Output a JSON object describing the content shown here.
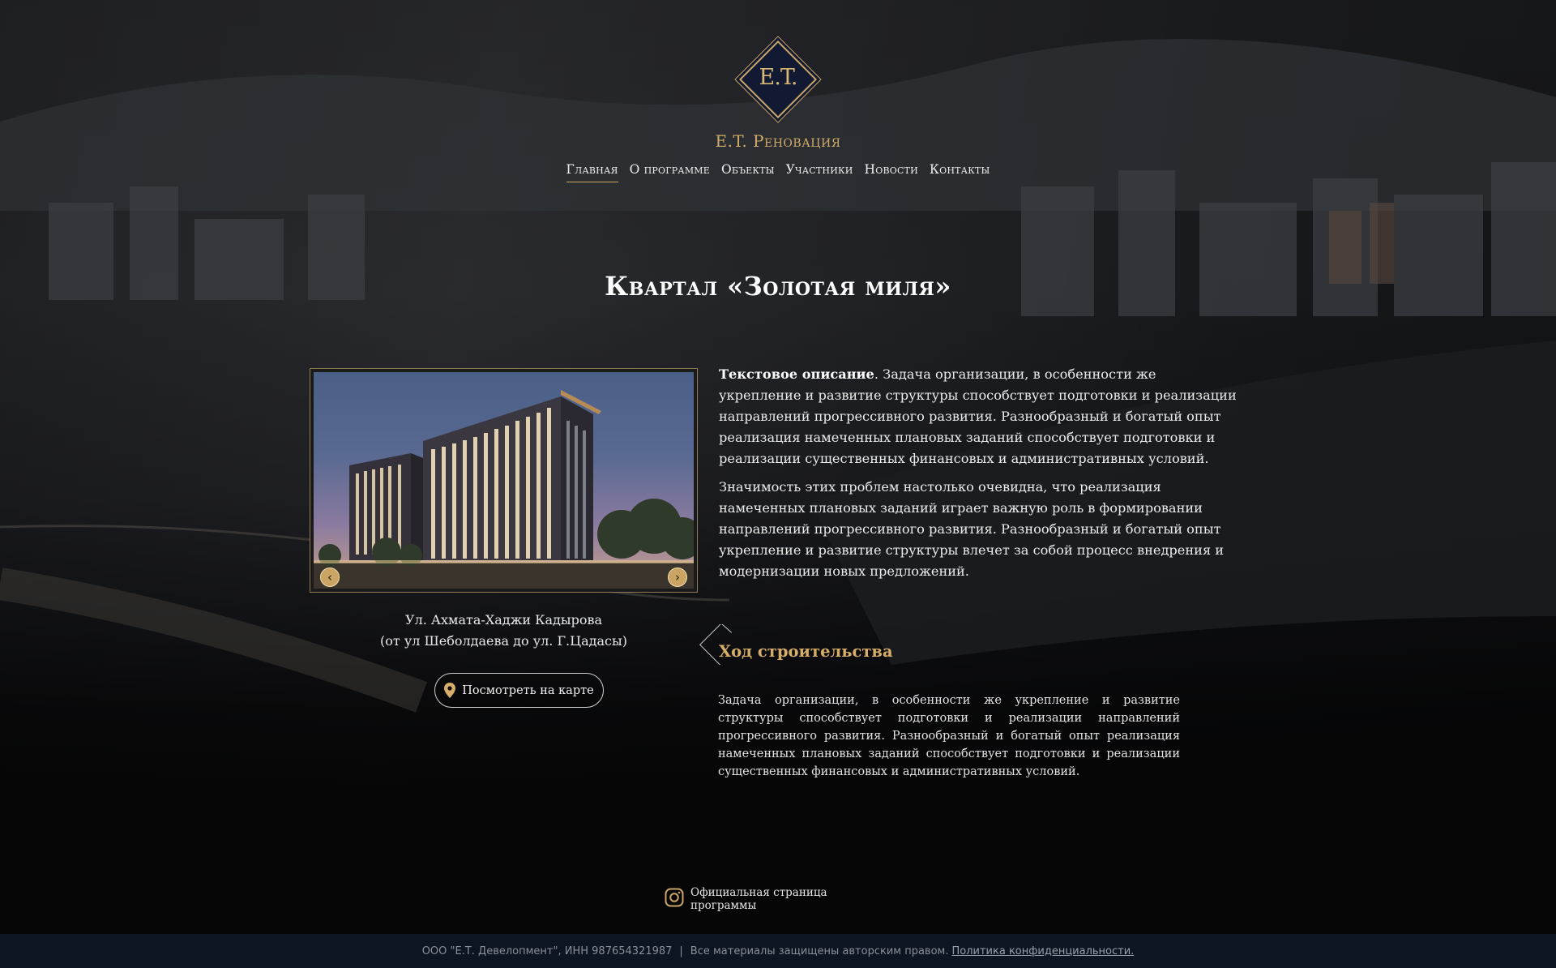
{
  "logo": {
    "monogram": "E.T."
  },
  "brand": {
    "name": "E.T. Реновация"
  },
  "nav": [
    {
      "label": "Главная",
      "active": true
    },
    {
      "label": "О программе"
    },
    {
      "label": "Объекты"
    },
    {
      "label": "Участники"
    },
    {
      "label": "Новости"
    },
    {
      "label": "Контакты"
    }
  ],
  "page": {
    "title": "Квартал «Золотая миля»"
  },
  "slider": {
    "prev_icon": "chevron-left-icon",
    "next_icon": "chevron-right-icon"
  },
  "address": {
    "line1": "Ул. Ахмата-Хаджи Кадырова",
    "line2": "(от ул Шеболдаева до ул. Г.Цадасы)"
  },
  "map_button": {
    "label": "Посмотреть на карте",
    "icon": "map-pin-icon"
  },
  "description": {
    "lead": "Текстовое описание",
    "p1": ". Задача организации, в особенности же укрепление и развитие структуры способствует подготовки и реализации направлений прогрессивного развития. Разнообразный и богатый опыт реализация намеченных плановых заданий способствует подготовки и реализации существенных финансовых и административных условий.",
    "p2": "Значимость этих проблем настолько очевидна, что реализация намеченных плановых заданий играет важную роль в формировании направлений прогрессивного развития. Разнообразный и богатый опыт укрепление и развитие структуры влечет за собой процесс внедрения и модернизации новых предложений."
  },
  "progress": {
    "title": "Ход строительства",
    "text": "Задача организации, в особенности же укрепление и развитие структуры способствует подготовки и реализации направлений прогрессивного развития. Разнообразный и богатый опыт реализация намеченных плановых заданий способствует подготовки и реализации существенных финансовых и административных условий."
  },
  "social": {
    "label": "Официальная страница программы",
    "icon": "instagram-icon"
  },
  "footer": {
    "company": "ООО \"Е.Т. Девелопмент\", ИНН 987654321987",
    "separator": "|",
    "rights": "Все материалы защищены авторским правом.",
    "privacy_link": "Политика конфиденциальности."
  },
  "colors": {
    "accent": "#c9a463",
    "navy": "#121a33",
    "footer_bar": "#0d1522"
  }
}
